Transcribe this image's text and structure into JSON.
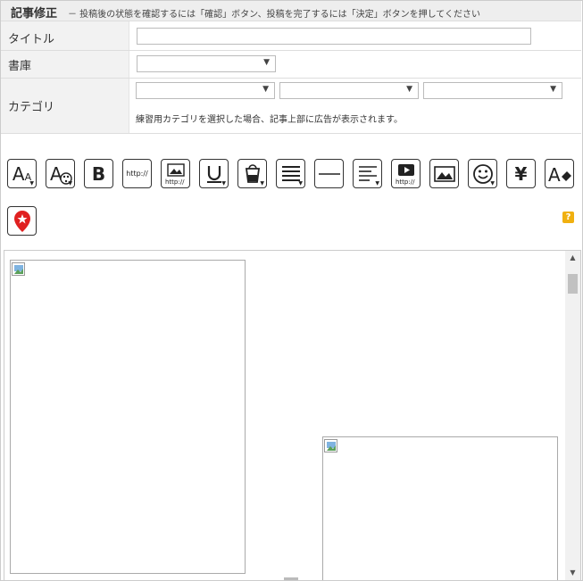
{
  "header": {
    "title": "記事修正",
    "description": "－ 投稿後の状態を確認するには「確認」ボタン、投稿を完了するには「決定」ボタンを押してください"
  },
  "form": {
    "title_label": "タイトル",
    "title_value": "",
    "library_label": "書庫",
    "library_value": "",
    "category_label": "カテゴリ",
    "category_selects": [
      "",
      "",
      ""
    ],
    "category_note": "練習用カテゴリを選択した場合、記事上部に広告が表示されます。"
  },
  "toolbar": {
    "buttons": [
      {
        "name": "font-size",
        "glyph": "AA"
      },
      {
        "name": "font-color",
        "glyph": "A"
      },
      {
        "name": "bold",
        "glyph": "B"
      },
      {
        "name": "link",
        "glyph": "http://"
      },
      {
        "name": "image-link",
        "glyph": "http://"
      },
      {
        "name": "underline",
        "glyph": "U"
      },
      {
        "name": "fill-color",
        "glyph": ""
      },
      {
        "name": "align",
        "glyph": ""
      },
      {
        "name": "horizontal-rule",
        "glyph": ""
      },
      {
        "name": "paragraph",
        "glyph": ""
      },
      {
        "name": "video-link",
        "glyph": "http://"
      },
      {
        "name": "image",
        "glyph": ""
      },
      {
        "name": "emoji",
        "glyph": ""
      },
      {
        "name": "yen",
        "glyph": "¥"
      },
      {
        "name": "eraser",
        "glyph": "A"
      },
      {
        "name": "map-pin",
        "glyph": ""
      }
    ],
    "help_label": "?"
  },
  "colors": {
    "header_bg": "#eeeeee",
    "label_bg": "#f2f2f2",
    "help_accent": "#f0b010",
    "map_pin": "#e02020"
  }
}
